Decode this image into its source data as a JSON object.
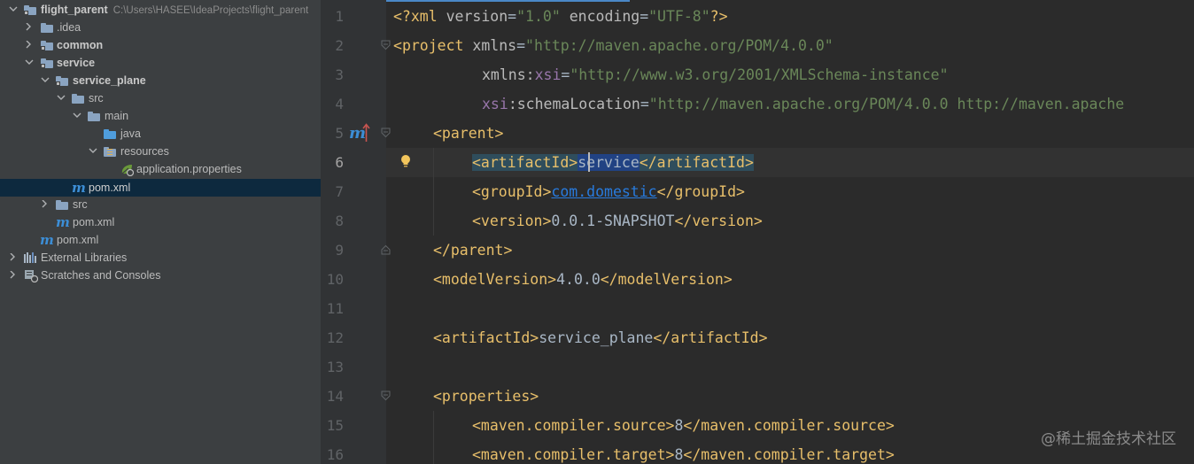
{
  "tree": {
    "root": {
      "label": "flight_parent",
      "path": "C:\\Users\\HASEE\\IdeaProjects\\flight_parent"
    },
    "idea": ".idea",
    "common": "common",
    "service": "service",
    "service_plane": "service_plane",
    "src_inner": "src",
    "main": "main",
    "java": "java",
    "resources": "resources",
    "app_props": "application.properties",
    "pom_plane": "pom.xml",
    "src_service": "src",
    "pom_service": "pom.xml",
    "pom_root": "pom.xml",
    "ext_libs": "External Libraries",
    "scratches": "Scratches and Consoles"
  },
  "editor": {
    "line_numbers": [
      "1",
      "2",
      "3",
      "4",
      "5",
      "6",
      "7",
      "8",
      "9",
      "10",
      "11",
      "12",
      "13",
      "14",
      "15",
      "16"
    ],
    "current_line": 6,
    "l1": {
      "a": "<?",
      "b": "xml ",
      "c": "version",
      "d": "=",
      "e": "\"1.0\"",
      "f": " encoding",
      "g": "=",
      "h": "\"UTF-8\"",
      "i": "?>"
    },
    "l2": {
      "open": "<",
      "tag": "project",
      "attr": " xmlns",
      "eq": "=",
      "val": "\"http://maven.apache.org/POM/4.0.0\""
    },
    "l3": {
      "attr": "xmlns",
      "colon": ":",
      "ns": "xsi",
      "eq": "=",
      "val": "\"http://www.w3.org/2001/XMLSchema-instance\""
    },
    "l4": {
      "ns": "xsi",
      "colon": ":",
      "attr": "schemaLocation",
      "eq": "=",
      "val": "\"http://maven.apache.org/POM/4.0.0 http://maven.apache"
    },
    "l5": {
      "text": "<parent>"
    },
    "l6": {
      "open": "<artifactId>",
      "value": "service",
      "close": "</artifactId>"
    },
    "l7": {
      "open": "<groupId>",
      "value": "com.domestic",
      "close": "</groupId>"
    },
    "l8": {
      "open": "<version>",
      "value": "0.0.1-SNAPSHOT",
      "close": "</version>"
    },
    "l9": {
      "text": "</parent>"
    },
    "l10": {
      "open": "<modelVersion>",
      "value": "4.0.0",
      "close": "</modelVersion>"
    },
    "l12": {
      "open": "<artifactId>",
      "value": "service_plane",
      "close": "</artifactId>"
    },
    "l14": {
      "text": "<properties>"
    },
    "l15": {
      "open": "<maven.compiler.source>",
      "value": "8",
      "close": "</maven.compiler.source>"
    },
    "l16": {
      "open": "<maven.compiler.target>",
      "value": "8",
      "close": "</maven.compiler.target>"
    },
    "maven_marker": "m"
  },
  "watermark": "@稀土掘金技术社区",
  "colors": {
    "tag": "#e8bf6a",
    "string": "#6a8759",
    "namespace": "#9876aa",
    "text": "#a9b7c6",
    "link": "#287bde",
    "selection": "#0d293e"
  },
  "icons": [
    "folder-icon",
    "maven-icon",
    "library-icon",
    "scratches-icon",
    "spring-config-icon",
    "lightbulb-icon",
    "chevron-right-icon",
    "chevron-down-icon",
    "fold-marker-icon",
    "override-arrow-icon"
  ]
}
